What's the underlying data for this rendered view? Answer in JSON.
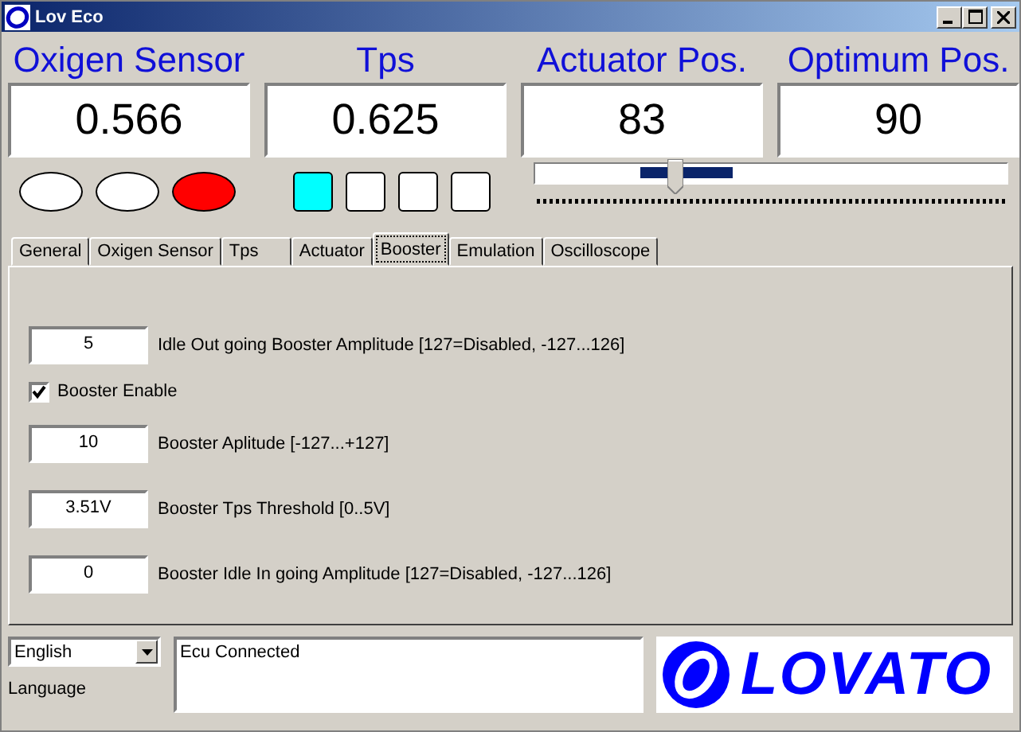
{
  "window": {
    "title": "Lov Eco"
  },
  "gauges": [
    {
      "label": "Oxigen Sensor",
      "value": "0.566"
    },
    {
      "label": "Tps",
      "value": "0.625"
    },
    {
      "label": "Actuator Pos.",
      "value": "83"
    },
    {
      "label": "Optimum Pos.",
      "value": "90"
    }
  ],
  "lamps": [
    {
      "color": "#ffffff"
    },
    {
      "color": "#ffffff"
    },
    {
      "color": "#ff0000"
    }
  ],
  "indicators": [
    {
      "color": "#00ffff"
    },
    {
      "color": "#ffffff"
    },
    {
      "color": "#ffffff"
    },
    {
      "color": "#ffffff"
    }
  ],
  "slider": {
    "level": 0.3
  },
  "tabs": [
    {
      "label": "General",
      "selected": false
    },
    {
      "label": "Oxigen Sensor",
      "selected": false
    },
    {
      "label": "Tps",
      "selected": false
    },
    {
      "label": "Actuator",
      "selected": false
    },
    {
      "label": "Booster",
      "selected": true
    },
    {
      "label": "Emulation",
      "selected": false
    },
    {
      "label": "Oscilloscope",
      "selected": false
    }
  ],
  "settings": [
    {
      "kind": "field",
      "value": "5",
      "caption": "Idle Out going Booster Amplitude [127=Disabled, -127...126]"
    },
    {
      "kind": "checkbox",
      "checked": true,
      "caption": "Booster Enable"
    },
    {
      "kind": "field",
      "value": "10",
      "caption": "Booster Aplitude [-127...+127]"
    },
    {
      "kind": "field",
      "value": "3.51V",
      "caption": "Booster Tps Threshold [0..5V]"
    },
    {
      "kind": "field",
      "value": "0",
      "caption": "Booster Idle In going Amplitude [127=Disabled, -127...126]"
    }
  ],
  "language": {
    "value": "English",
    "label": "Language"
  },
  "status": "Ecu Connected",
  "logo": "LOVATO"
}
